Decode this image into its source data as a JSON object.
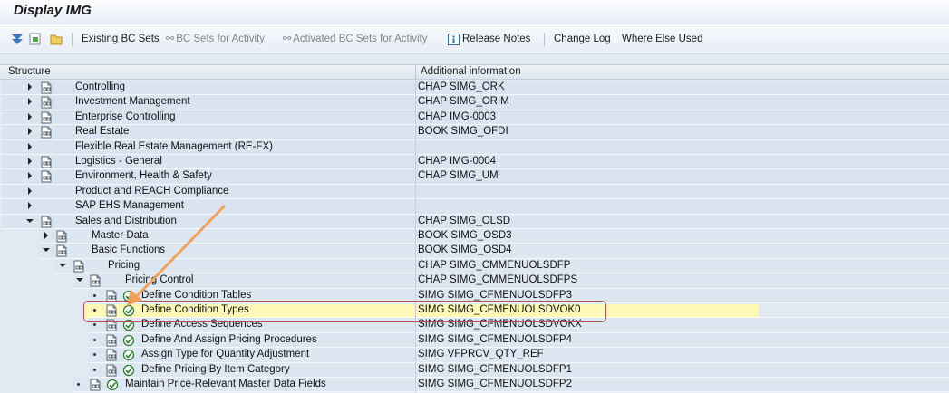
{
  "window": {
    "title": "Display IMG"
  },
  "toolbar": {
    "existing_bc_sets": "Existing BC Sets",
    "bc_sets_for_activity": "BC Sets for Activity",
    "activated_bc_sets": "Activated BC Sets for Activity",
    "release_notes": "Release Notes",
    "change_log": "Change Log",
    "where_else_used": "Where Else Used"
  },
  "columns": {
    "structure": "Structure",
    "additional": "Additional information"
  },
  "rows": [
    {
      "text": "Controlling",
      "info": "CHAP SIMG_ORK"
    },
    {
      "text": "Investment Management",
      "info": "CHAP SIMG_ORIM"
    },
    {
      "text": "Enterprise Controlling",
      "info": "CHAP IMG-0003"
    },
    {
      "text": "Real Estate",
      "info": "BOOK SIMG_OFDI"
    },
    {
      "text": "Flexible Real Estate Management (RE-FX)",
      "info": ""
    },
    {
      "text": "Logistics - General",
      "info": "CHAP IMG-0004"
    },
    {
      "text": "Environment, Health & Safety",
      "info": "CHAP SIMG_UM"
    },
    {
      "text": "Product and REACH Compliance",
      "info": ""
    },
    {
      "text": "SAP EHS Management",
      "info": ""
    },
    {
      "text": "Sales and Distribution",
      "info": "CHAP SIMG_OLSD"
    },
    {
      "text": "Master Data",
      "info": "BOOK SIMG_OSD3"
    },
    {
      "text": "Basic Functions",
      "info": "BOOK SIMG_OSD4"
    },
    {
      "text": "Pricing",
      "info": "CHAP SIMG_CMMENUOLSDFP"
    },
    {
      "text": "Pricing Control",
      "info": "CHAP SIMG_CMMENUOLSDFPS"
    },
    {
      "text": "Define Condition Tables",
      "info": "SIMG SIMG_CFMENUOLSDFP3"
    },
    {
      "text": "Define Condition Types",
      "info": "SIMG SIMG_CFMENUOLSDVOK0"
    },
    {
      "text": "Define Access Sequences",
      "info": "SIMG SIMG_CFMENUOLSDVOKX"
    },
    {
      "text": "Define And Assign Pricing Procedures",
      "info": "SIMG SIMG_CFMENUOLSDFP4"
    },
    {
      "text": "Assign Type for Quantity Adjustment",
      "info": "SIMG VFPRCV_QTY_REF"
    },
    {
      "text": "Define Pricing By Item Category",
      "info": "SIMG SIMG_CFMENUOLSDFP1"
    },
    {
      "text": "Maintain Price-Relevant Master Data Fields",
      "info": "SIMG SIMG_CFMENUOLSDFP2"
    }
  ],
  "colors": {
    "highlight": "#fff9b8",
    "callout_border": "#b9504b",
    "arrow": "#f0a25a"
  }
}
